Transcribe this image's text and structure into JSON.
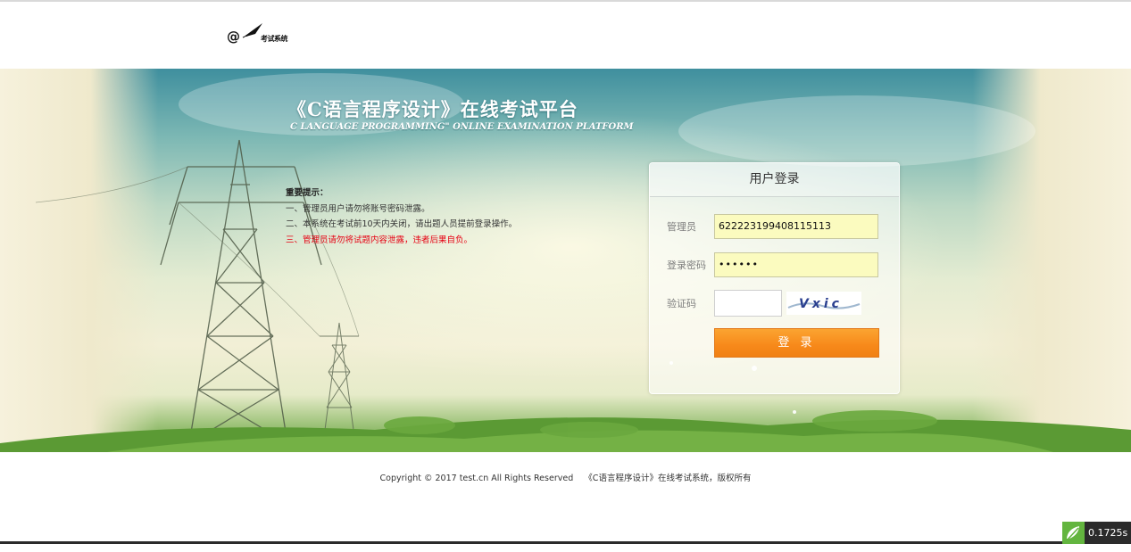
{
  "header": {
    "logo_symbol": "@",
    "logo_text": "考试系统"
  },
  "banner": {
    "title_cn": "《C语言程序设计》在线考试平台",
    "title_en": "C LANGUAGE PROGRAMMING\" ONLINE EXAMINATION PLATFORM"
  },
  "notice": {
    "title": "重要提示：",
    "items": [
      "一、管理员用户请勿将账号密码泄露。",
      "二、本系统在考试前10天内关闭，请出题人员提前登录操作。",
      "三、管理员请勿将试题内容泄露，违者后果自负。"
    ],
    "warning_color": "#e60012"
  },
  "login": {
    "title": "用户登录",
    "username_label": "管理员",
    "username_value": "622223199408115113",
    "password_label": "登录密码",
    "password_value": "••••••",
    "captcha_label": "验证码",
    "captcha_value": "",
    "captcha_image_text": "Vxic",
    "submit_label": "登 录",
    "button_color": "#f7891a",
    "input_bg_color": "#fbfbbf"
  },
  "footer": {
    "copyright": "Copyright © 2017 test.cn All Rights Reserved    《C语言程序设计》在线考试系统，版权所有"
  },
  "timer": {
    "value": "0.1725s",
    "icon": "leaf-logo-icon"
  }
}
